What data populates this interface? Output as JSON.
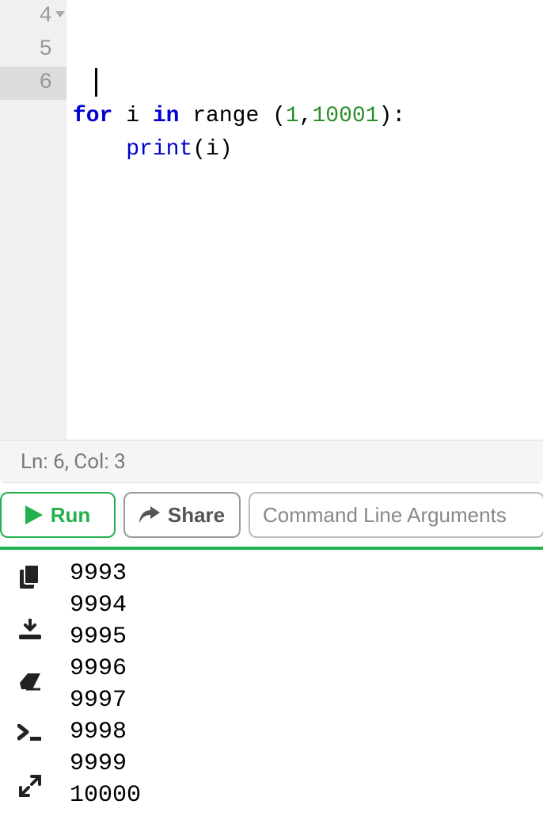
{
  "editor": {
    "lines": [
      {
        "number": "4",
        "foldable": true,
        "tokens": [
          {
            "t": "for",
            "c": "kw"
          },
          {
            "t": " i ",
            "c": ""
          },
          {
            "t": "in",
            "c": "kw"
          },
          {
            "t": " range (",
            "c": ""
          },
          {
            "t": "1",
            "c": "num"
          },
          {
            "t": ",",
            "c": ""
          },
          {
            "t": "10001",
            "c": "num"
          },
          {
            "t": "):",
            "c": ""
          }
        ]
      },
      {
        "number": "5",
        "foldable": false,
        "tokens": [
          {
            "t": "    ",
            "c": ""
          },
          {
            "t": "print",
            "c": "fn"
          },
          {
            "t": "(i)",
            "c": ""
          }
        ]
      },
      {
        "number": "6",
        "foldable": false,
        "active": true,
        "tokens": []
      }
    ]
  },
  "status": {
    "text": "Ln: 6,  Col: 3"
  },
  "toolbar": {
    "run_label": "Run",
    "share_label": "Share",
    "cmd_placeholder": "Command Line Arguments"
  },
  "output": {
    "lines": [
      "9993",
      "9994",
      "9995",
      "9996",
      "9997",
      "9998",
      "9999",
      "10000"
    ]
  },
  "icons": {
    "copy": "copy-icon",
    "download": "download-icon",
    "erase": "erase-icon",
    "terminal": "terminal-icon",
    "expand": "expand-icon",
    "play": "play-icon",
    "share": "share-icon"
  }
}
